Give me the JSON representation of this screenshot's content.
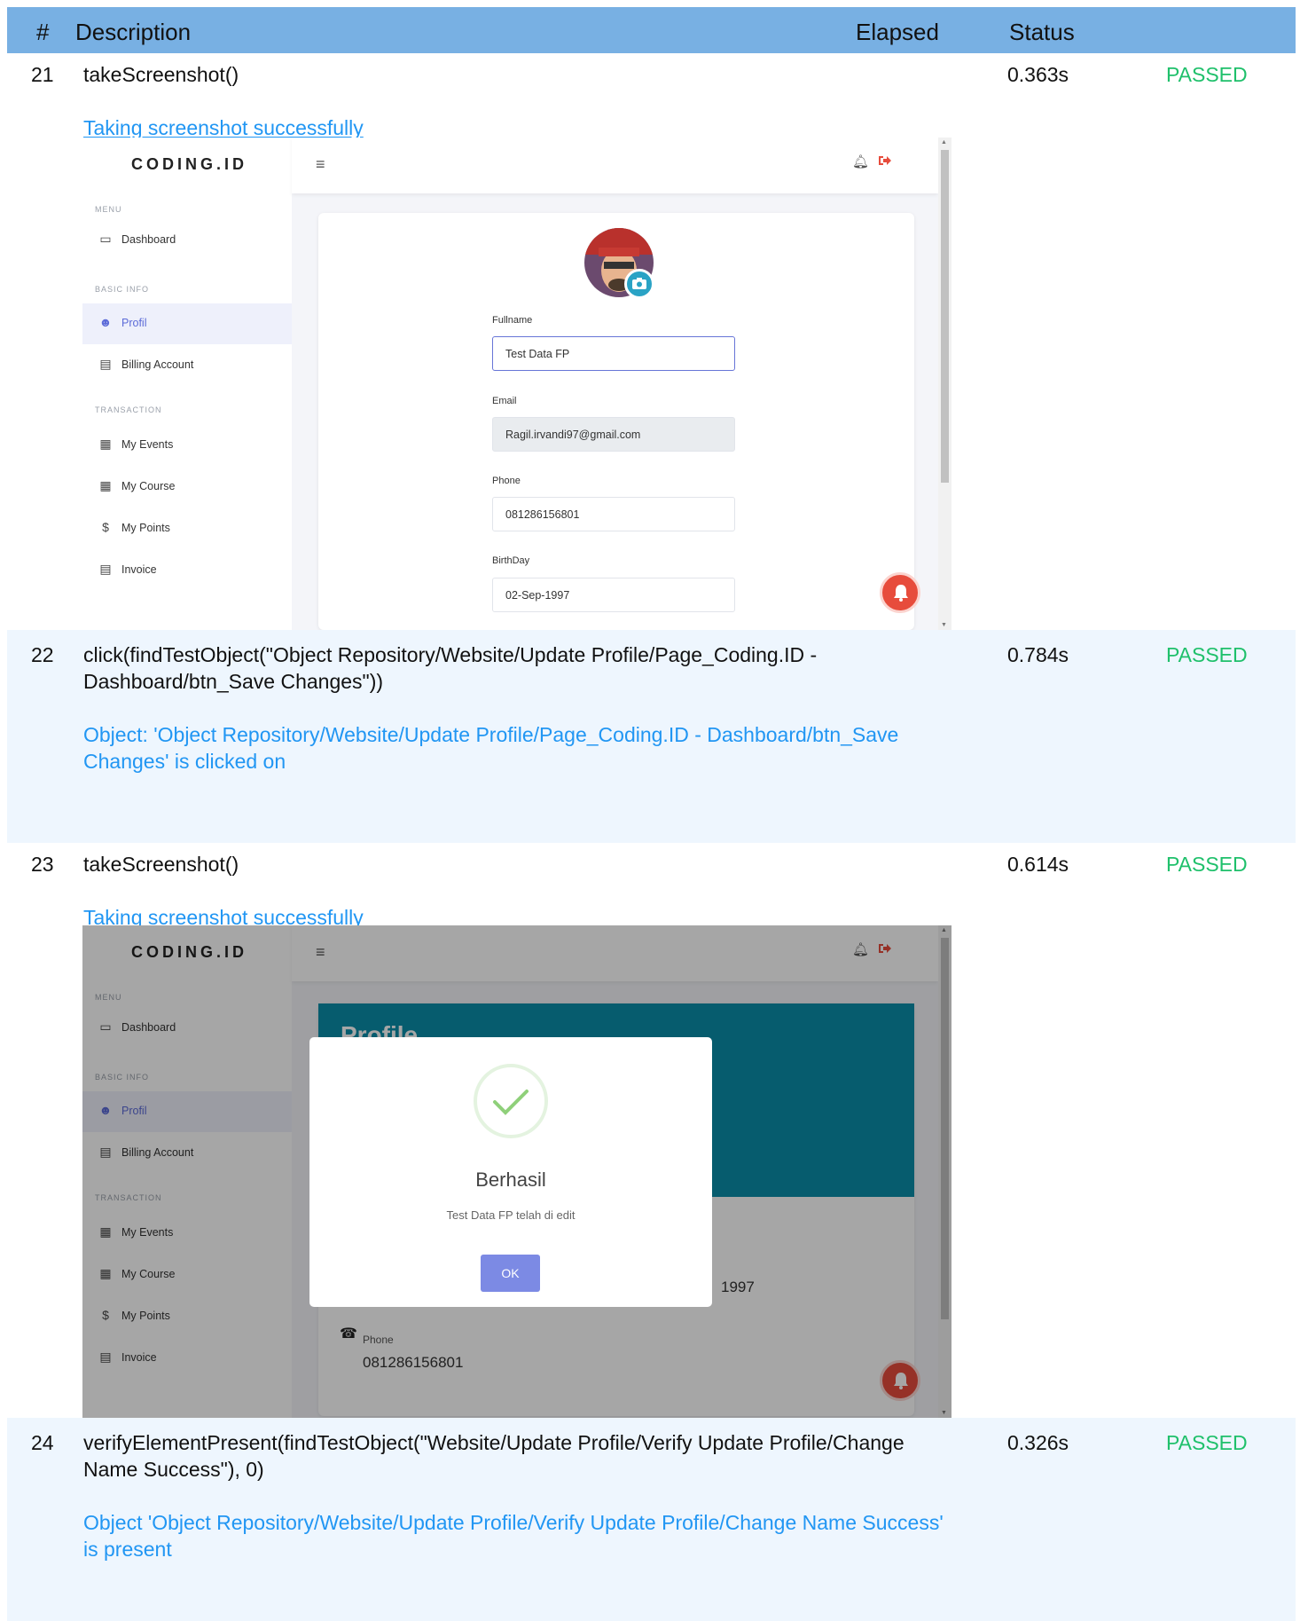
{
  "header": {
    "num": "#",
    "description": "Description",
    "elapsed": "Elapsed",
    "status": "Status"
  },
  "steps": [
    {
      "num": "21",
      "description": "takeScreenshot()",
      "elapsed": "0.363s",
      "status": "PASSED",
      "message": "Taking screenshot successfully"
    },
    {
      "num": "22",
      "description": "click(findTestObject(\"Object Repository/Website/Update Profile/Page_Coding.ID - Dashboard/btn_Save Changes\"))",
      "elapsed": "0.784s",
      "status": "PASSED",
      "message": "Object: 'Object Repository/Website/Update Profile/Page_Coding.ID - Dashboard/btn_Save Changes' is clicked on"
    },
    {
      "num": "23",
      "description": "takeScreenshot()",
      "elapsed": "0.614s",
      "status": "PASSED",
      "message": "Taking screenshot successfully"
    },
    {
      "num": "24",
      "description": "verifyElementPresent(findTestObject(\"Website/Update Profile/Verify Update Profile/Change Name Success\"), 0)",
      "elapsed": "0.326s",
      "status": "PASSED",
      "message": "Object 'Object Repository/Website/Update Profile/Verify Update Profile/Change Name Success' is present"
    }
  ],
  "app": {
    "logo": "CODING.ID",
    "menu_head": "MENU",
    "basic_info_head": "BASIC INFO",
    "transaction_head": "TRANSACTION",
    "items": {
      "dashboard": "Dashboard",
      "profil": "Profil",
      "billing": "Billing Account",
      "events": "My Events",
      "course": "My Course",
      "points": "My Points",
      "invoice": "Invoice"
    },
    "form": {
      "fullname_label": "Fullname",
      "fullname_value": "Test Data FP",
      "email_label": "Email",
      "email_value": "Ragil.irvandi97@gmail.com",
      "phone_label": "Phone",
      "phone_value": "081286156801",
      "birthday_label": "BirthDay",
      "birthday_value": "02-Sep-1997"
    },
    "profile_page": {
      "title": "Profile",
      "year_fragment": "1997",
      "phone_label": "Phone",
      "phone_value": "081286156801"
    },
    "modal": {
      "title": "Berhasil",
      "text": "Test Data FP telah di edit",
      "ok": "OK"
    }
  },
  "colors": {
    "header": "#78b0e3",
    "passed": "#1fc06b",
    "message": "#2196f3",
    "accent": "#5c6bd8"
  }
}
